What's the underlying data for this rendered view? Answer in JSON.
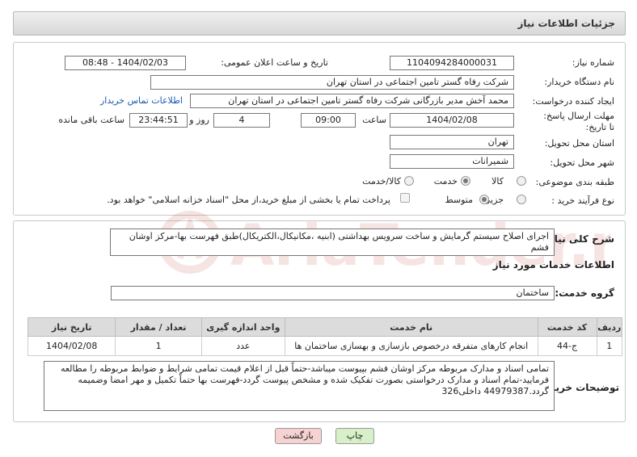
{
  "header": {
    "title": "جزئیات اطلاعات نیاز"
  },
  "form": {
    "need_number_label": "شماره نیاز:",
    "need_number": "1104094284000031",
    "announce_label": "تاریخ و ساعت اعلان عمومی:",
    "announce_value": "1404/02/03 - 08:48",
    "buyer_org_label": "نام دستگاه خریدار:",
    "buyer_org": "شرکت رفاه گستر تامین اجتماعی در استان تهران",
    "requester_label": "ایجاد کننده درخواست:",
    "requester": "محمد آخش مدیر بازرگانی شرکت رفاه گستر تامین اجتماعی در استان تهران",
    "contact_link": "اطلاعات تماس خریدار",
    "deadline_label": "مهلت ارسال پاسخ: تا تاریخ:",
    "deadline_date": "1404/02/08",
    "time_label": "ساعت",
    "deadline_time": "09:00",
    "days_value": "4",
    "days_label": "روز و",
    "remaining_time": "23:44:51",
    "remaining_label": "ساعت باقی مانده",
    "province_label": "استان محل تحویل:",
    "province": "تهران",
    "city_label": "شهر محل تحویل:",
    "city": "شمیرانات",
    "category_label": "طبقه بندی موضوعی:",
    "category_options": [
      "کالا",
      "خدمت",
      "کالا/خدمت"
    ],
    "category_selected": "خدمت",
    "process_label": "نوع فرآیند خرید :",
    "process_options": [
      "جزیی",
      "متوسط"
    ],
    "process_selected": "متوسط",
    "payment_note": "پرداخت تمام یا بخشی از مبلغ خرید،از محل \"اسناد خزانه اسلامی\" خواهد بود."
  },
  "details": {
    "summary_label": "شرح کلی نیاز:",
    "summary": "اجرای اصلاح سیستم گرمایش و ساخت سرویس بهداشتی (ابنیه ،مکانیکال،الکتریکال)طبق فهرست بها-مرکز اوشان فشم",
    "services_heading": "اطلاعات خدمات مورد نیاز",
    "service_group_label": "گروه خدمت:",
    "service_group": "ساختمان",
    "table": {
      "headers": [
        "ردیف",
        "کد خدمت",
        "نام خدمت",
        "واحد اندازه گیری",
        "تعداد / مقدار",
        "تاریخ نیاز"
      ],
      "rows": [
        [
          "1",
          "ج-44",
          "انجام کارهای متفرقه درخصوص بازسازی و بهسازی ساختمان ها",
          "عدد",
          "1",
          "1404/02/08"
        ]
      ]
    },
    "buyer_notes_label": "توضیحات خریدار:",
    "buyer_notes": "تمامی اسناد و مدارک مربوطه مرکز اوشان فشم بپیوست میباشد-حتماً قبل از اعلام قیمت تمامی شرایط و ضوابط مربوطه را مطالعه فرمایید-تمام اسناد و مدارک درخواستی بصورت تفکیک شده و مشخص پیوست گردد-فهرست بها حتماً تکمیل و مهر امضا وضمیمه گردد.44979387 داخلی326"
  },
  "buttons": {
    "print": "چاپ",
    "back": "بازگشت"
  },
  "watermark_text": "AriaTender.neT",
  "colors": {
    "link": "#1a58b0",
    "print_button": "#d8f0c8",
    "back_button": "#f7d2d2",
    "watermark": "#c0392b"
  }
}
